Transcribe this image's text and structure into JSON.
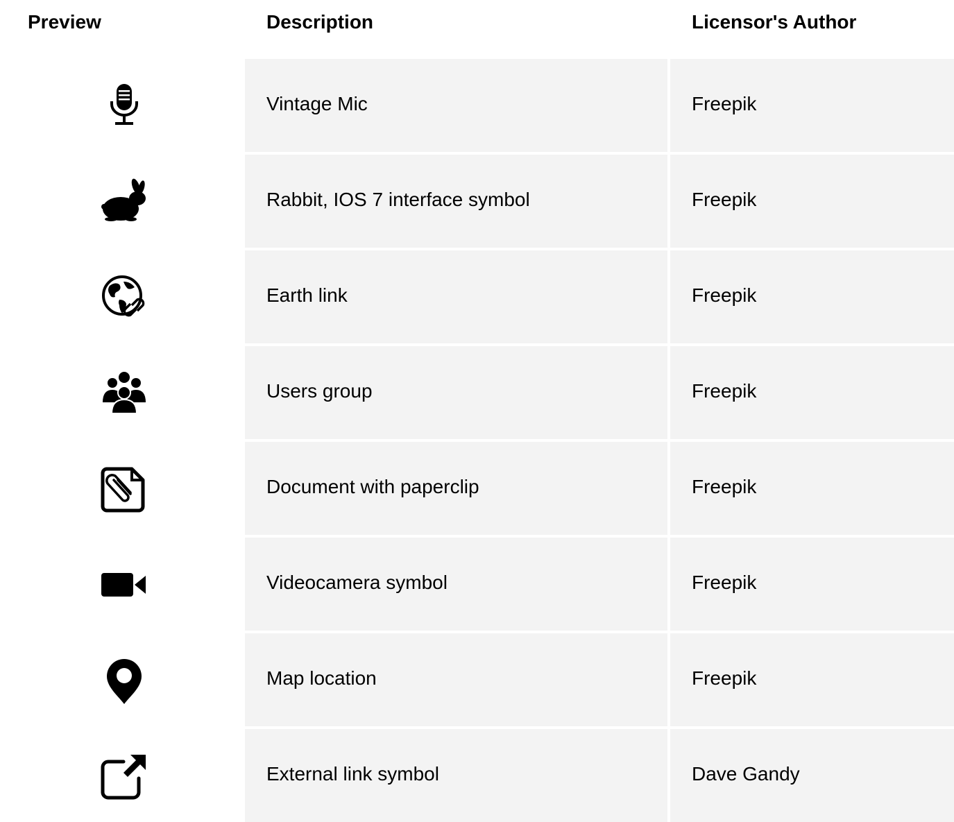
{
  "headers": {
    "preview": "Preview",
    "description": "Description",
    "author": "Licensor's Author"
  },
  "rows": [
    {
      "icon": "vintage-mic-icon",
      "description": "Vintage Mic",
      "author": "Freepik"
    },
    {
      "icon": "rabbit-icon",
      "description": "Rabbit, IOS 7 interface symbol",
      "author": "Freepik"
    },
    {
      "icon": "earth-link-icon",
      "description": "Earth link",
      "author": "Freepik"
    },
    {
      "icon": "users-group-icon",
      "description": "Users group",
      "author": "Freepik"
    },
    {
      "icon": "document-paperclip-icon",
      "description": "Document with paperclip",
      "author": "Freepik"
    },
    {
      "icon": "videocamera-icon",
      "description": "Videocamera symbol",
      "author": "Freepik"
    },
    {
      "icon": "map-location-icon",
      "description": "Map location",
      "author": "Freepik"
    },
    {
      "icon": "external-link-icon",
      "description": "External link symbol",
      "author": "Dave Gandy"
    }
  ],
  "colors": {
    "cell_background": "#f3f3f3",
    "text": "#000000",
    "background": "#ffffff"
  }
}
